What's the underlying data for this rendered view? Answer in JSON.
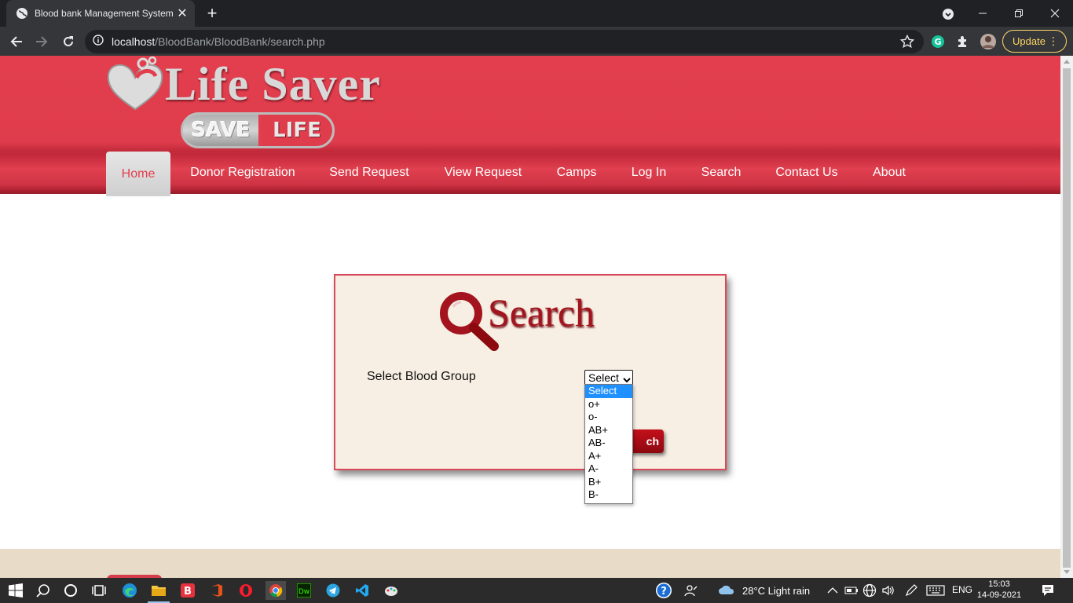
{
  "browser": {
    "tab_title": "Blood bank Management System",
    "url_host": "localhost",
    "url_path": "/BloodBank/BloodBank/search.php",
    "update_label": "Update"
  },
  "logo": {
    "title": "Life Saver",
    "badge_left": "SAVE",
    "badge_right": "LIFE"
  },
  "nav": {
    "items": [
      {
        "label": "Home",
        "active": true
      },
      {
        "label": "Donor Registration"
      },
      {
        "label": "Send Request"
      },
      {
        "label": "View Request"
      },
      {
        "label": "Camps"
      },
      {
        "label": "Log In"
      },
      {
        "label": "Search"
      },
      {
        "label": "Contact Us"
      },
      {
        "label": "About"
      }
    ]
  },
  "search": {
    "heading": "Search",
    "label": "Select Blood Group",
    "selected": "Select",
    "button_label_visible": "ch",
    "options": [
      "Select",
      "o+",
      "o-",
      "AB+",
      "AB-",
      "A+",
      "A-",
      "B+",
      "B-"
    ]
  },
  "taskbar": {
    "weather": "28°C  Light rain",
    "lang": "ENG",
    "time": "15:03",
    "date": "14-09-2021"
  },
  "colors": {
    "brand_red": "#e23e4e",
    "search_red": "#a3141e",
    "panel_bg": "#f7efe3",
    "footer_bg": "#e8dcc8"
  }
}
